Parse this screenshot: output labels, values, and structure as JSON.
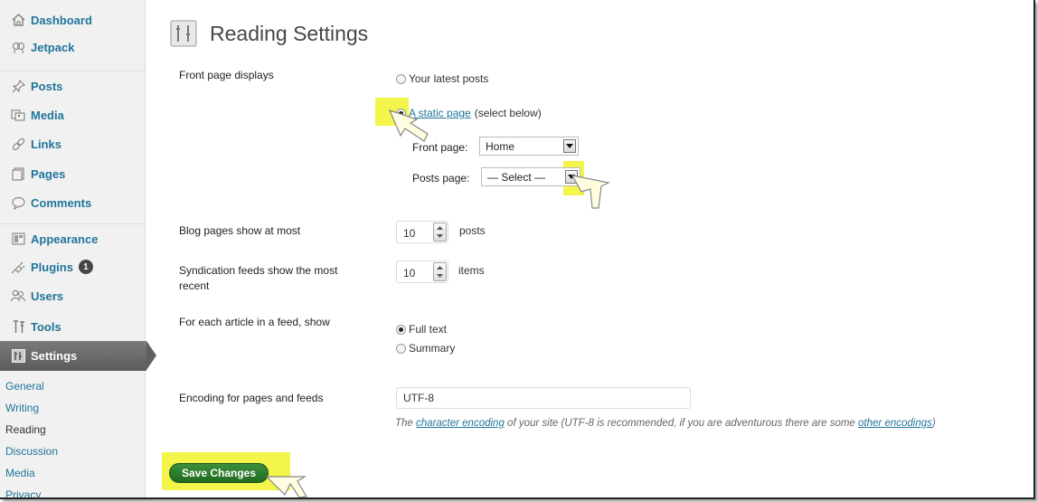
{
  "sidebar": {
    "items": [
      {
        "label": "Dashboard",
        "icon": "house-icon"
      },
      {
        "label": "Jetpack",
        "icon": "jetpack-icon"
      },
      {
        "label": "Posts",
        "icon": "pushpin-icon"
      },
      {
        "label": "Media",
        "icon": "media-icon"
      },
      {
        "label": "Links",
        "icon": "chain-link-icon"
      },
      {
        "label": "Pages",
        "icon": "pages-icon"
      },
      {
        "label": "Comments",
        "icon": "speech-bubble-icon"
      },
      {
        "label": "Appearance",
        "icon": "appearance-icon"
      },
      {
        "label": "Plugins",
        "icon": "plug-icon",
        "badge": "1"
      },
      {
        "label": "Users",
        "icon": "users-icon"
      },
      {
        "label": "Tools",
        "icon": "tools-icon"
      },
      {
        "label": "Settings",
        "icon": "settings-icon"
      }
    ],
    "submenu": [
      "General",
      "Writing",
      "Reading",
      "Discussion",
      "Media",
      "Privacy"
    ],
    "current_submenu": "Reading"
  },
  "page": {
    "title": "Reading Settings"
  },
  "front_page": {
    "label": "Front page displays",
    "option_latest": "Your latest posts",
    "option_static_link": "A static page",
    "option_static_suffix": "(select below)",
    "front_page_label": "Front page:",
    "front_page_value": "Home",
    "posts_page_label": "Posts page:",
    "posts_page_value": "— Select —"
  },
  "blog_pages": {
    "label": "Blog pages show at most",
    "value": "10",
    "suffix": "posts"
  },
  "syndication": {
    "label_line1": "Syndication feeds show the most",
    "label_line2": "recent",
    "value": "10",
    "suffix": "items"
  },
  "feed_article": {
    "label": "For each article in a feed, show",
    "option_full": "Full text",
    "option_summary": "Summary"
  },
  "encoding": {
    "label": "Encoding for pages and feeds",
    "value": "UTF-8",
    "desc_before": "The",
    "desc_link1": "character encoding",
    "desc_middle": "of your site (UTF-8 is recommended, if you are adventurous there are some",
    "desc_link2": "other encodings",
    "desc_after": ")"
  },
  "actions": {
    "save_label": "Save Changes"
  },
  "colors": {
    "link": "#21759b",
    "highlight": "#f4f54a",
    "save_button": "#2a7d2a",
    "active_menu": "#6a6a6a"
  }
}
